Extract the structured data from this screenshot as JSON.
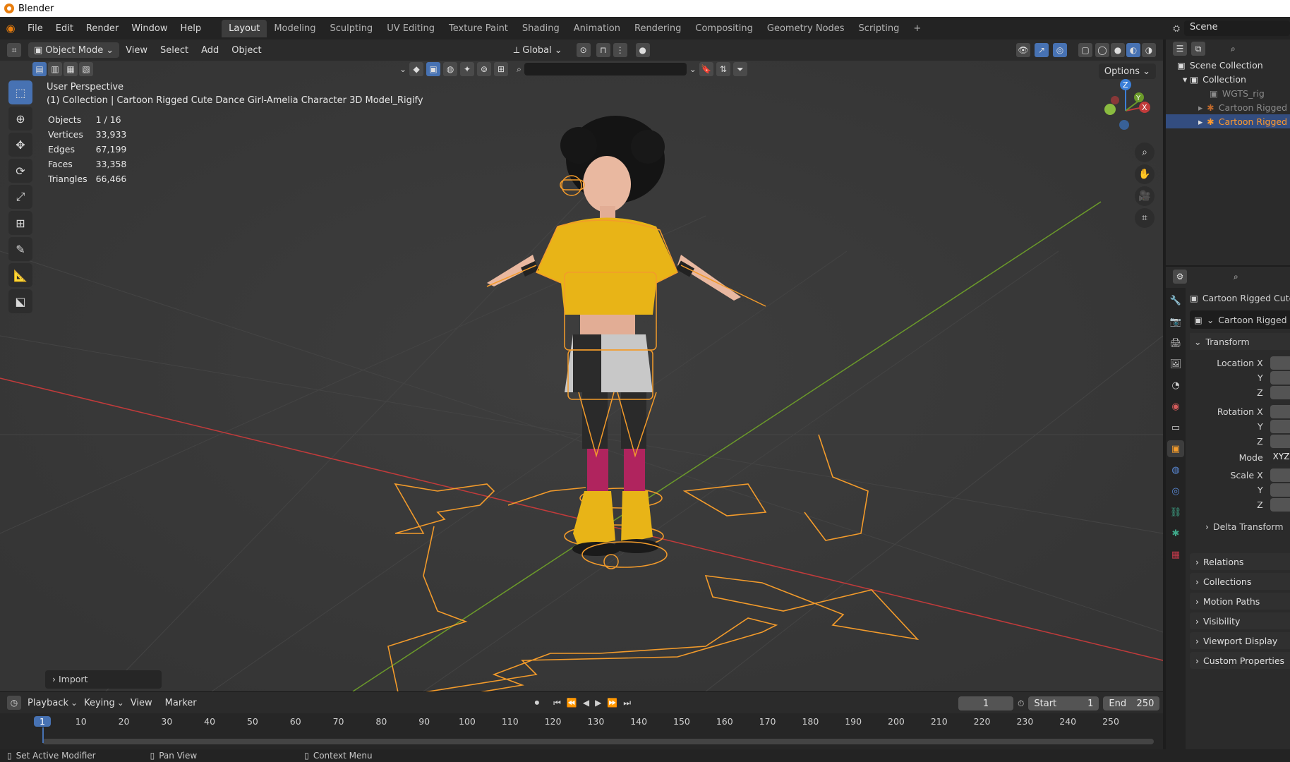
{
  "app": {
    "title": "Blender"
  },
  "menu": [
    "File",
    "Edit",
    "Render",
    "Window",
    "Help"
  ],
  "workspaces": [
    "Layout",
    "Modeling",
    "Sculpting",
    "UV Editing",
    "Texture Paint",
    "Shading",
    "Animation",
    "Rendering",
    "Compositing",
    "Geometry Nodes",
    "Scripting"
  ],
  "scene": {
    "name": "Scene"
  },
  "viewport_header": {
    "mode": "Object Mode",
    "menus": [
      "View",
      "Select",
      "Add",
      "Object"
    ],
    "orientation": "Global",
    "options_label": "Options"
  },
  "overlay": {
    "view_name": "User Perspective",
    "collection_line": "(1) Collection | Cartoon Rigged Cute Dance Girl-Amelia Character 3D Model_Rigify"
  },
  "stats": [
    {
      "label": "Objects",
      "value": "1 / 16"
    },
    {
      "label": "Vertices",
      "value": "33,933"
    },
    {
      "label": "Edges",
      "value": "67,199"
    },
    {
      "label": "Faces",
      "value": "33,358"
    },
    {
      "label": "Triangles",
      "value": "66,466"
    }
  ],
  "gizmo": {
    "x": "X",
    "y": "Y",
    "z": "Z"
  },
  "import_panel": "Import",
  "timeline": {
    "menus": [
      "Playback",
      "Keying",
      "View",
      "Marker"
    ],
    "current_frame": "1",
    "start_label": "Start",
    "start_value": "1",
    "end_label": "End",
    "end_value": "250",
    "ticks": [
      "1",
      "10",
      "20",
      "30",
      "40",
      "50",
      "60",
      "70",
      "80",
      "90",
      "100",
      "110",
      "120",
      "130",
      "140",
      "150",
      "160",
      "170",
      "180",
      "190",
      "200",
      "210",
      "220",
      "230",
      "240",
      "250"
    ]
  },
  "statusbar": [
    "Set Active Modifier",
    "Pan View",
    "Context Menu"
  ],
  "outliner": {
    "rows": [
      {
        "label": "Scene Collection"
      },
      {
        "label": "Collection"
      },
      {
        "label": "WGTS_rig"
      },
      {
        "label": "Cartoon Rigged Cute Dance Girl"
      },
      {
        "label": "Cartoon Rigged Cute Dance Girl"
      }
    ]
  },
  "properties": {
    "object_name": "Cartoon Rigged Cute Dance Girl",
    "datablock_name": "Cartoon Rigged Cute Dance Girl",
    "transform_label": "Transform",
    "rows": [
      {
        "label": "Location X"
      },
      {
        "label": "Y"
      },
      {
        "label": "Z"
      },
      {
        "label": "Rotation X"
      },
      {
        "label": "Y"
      },
      {
        "label": "Z"
      },
      {
        "label": "Mode",
        "value": "XYZ"
      },
      {
        "label": "Scale X"
      },
      {
        "label": "Y"
      },
      {
        "label": "Z"
      }
    ],
    "delta_transform": "Delta Transform",
    "panels": [
      "Relations",
      "Collections",
      "Motion Paths",
      "Visibility",
      "Viewport Display",
      "Custom Properties"
    ]
  },
  "colors": {
    "accent_blue": "#4772b3",
    "selection_orange": "#ff9a2e",
    "x_axis": "#c23b3b",
    "y_axis": "#6b9a2a"
  }
}
